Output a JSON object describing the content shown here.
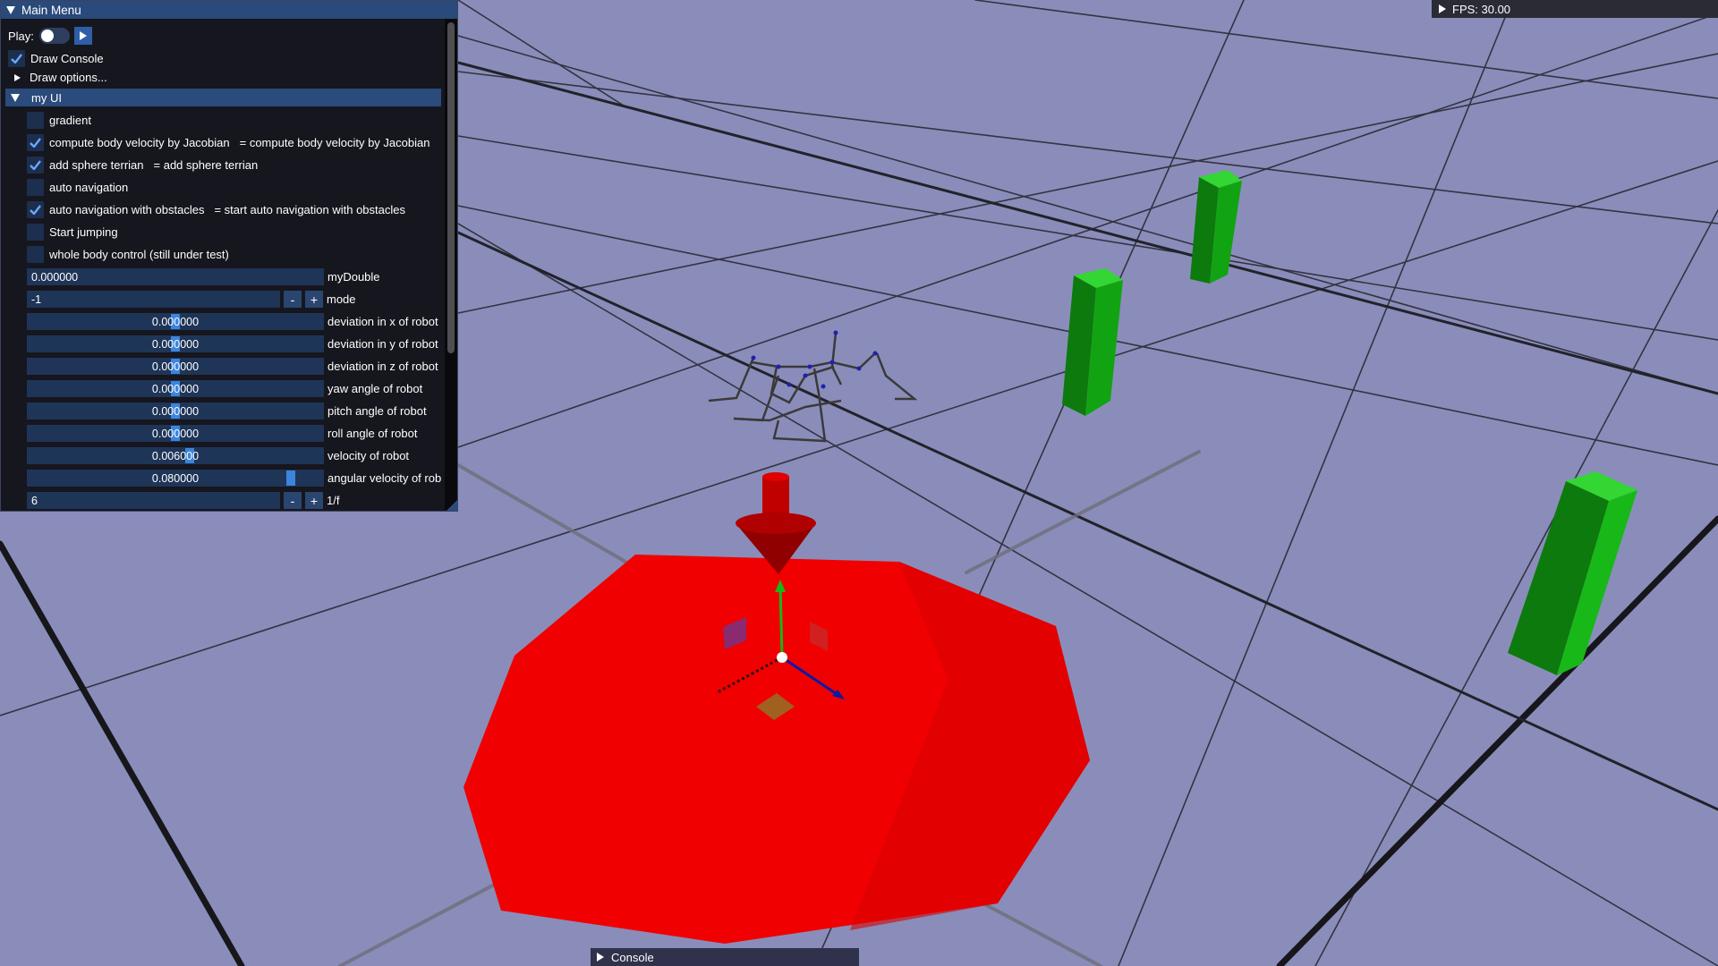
{
  "main_menu": {
    "title": "Main Menu",
    "play_label": "Play:",
    "play_enabled": false,
    "draw_console": {
      "label": "Draw Console",
      "checked": true
    },
    "draw_options": {
      "label": "Draw options..."
    },
    "my_ui": {
      "label": "my UI",
      "checkboxes": [
        {
          "label": "gradient",
          "checked": false,
          "extra": ""
        },
        {
          "label": "compute body velocity by Jacobian",
          "checked": true,
          "extra": "= compute body velocity by Jacobian"
        },
        {
          "label": "add sphere terrian",
          "checked": true,
          "extra": "= add sphere terrian"
        },
        {
          "label": "auto navigation",
          "checked": false,
          "extra": ""
        },
        {
          "label": "auto navigation with obstacles",
          "checked": true,
          "extra": "= start auto navigation with obstacles"
        },
        {
          "label": "Start jumping",
          "checked": false,
          "extra": ""
        },
        {
          "label": "whole body control (still under test)",
          "checked": false,
          "extra": ""
        }
      ],
      "my_double": {
        "value": "0.000000",
        "label": "myDouble"
      },
      "mode": {
        "value": "-1",
        "label": "mode",
        "minus": "-",
        "plus": "+"
      },
      "sliders": [
        {
          "value": "0.000000",
          "label": "deviation in x of robot",
          "level": 0.5
        },
        {
          "value": "0.000000",
          "label": "deviation in y of robot",
          "level": 0.5
        },
        {
          "value": "0.000000",
          "label": "deviation in z of robot",
          "level": 0.5
        },
        {
          "value": "0.000000",
          "label": "yaw angle of robot",
          "level": 0.5
        },
        {
          "value": "0.000000",
          "label": "pitch angle of robot",
          "level": 0.5
        },
        {
          "value": "0.000000",
          "label": "roll angle of robot",
          "level": 0.5
        },
        {
          "value": "0.006000",
          "label": "velocity of robot",
          "level": 0.55
        },
        {
          "value": "0.080000",
          "label": "angular velocity of rob",
          "level": 0.9
        }
      ],
      "inv_f": {
        "value": "6",
        "label": "1/f",
        "minus": "-",
        "plus": "+"
      }
    }
  },
  "fps": {
    "label": "FPS: 30.00"
  },
  "console": {
    "label": "Console"
  },
  "colors": {
    "ground": "#8a8dba",
    "grid_line": "#1c1c22",
    "panel_bg": "#0f0f14",
    "title_bar": "#294a7a",
    "field": "#1f3558",
    "accent": "#3d84dc",
    "terrain_red": "#f00000",
    "obstacle_green": "#18b818"
  },
  "icons": [
    "collapse-triangle-icon",
    "play-icon",
    "checkmark-icon",
    "expand-triangle-icon"
  ]
}
